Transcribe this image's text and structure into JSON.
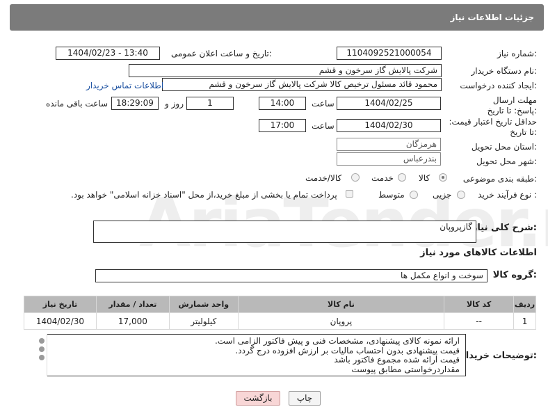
{
  "header": {
    "title": "جزئیات اطلاعات نیاز"
  },
  "watermark": "AriaTender.neT",
  "fields": {
    "need_number_label": "شماره نیاز:",
    "need_number": "1104092521000054",
    "announce_label": "تاریخ و ساعت اعلان عمومی:",
    "announce_value": "1404/02/23 - 13:40",
    "buyer_label": "نام دستگاه خریدار:",
    "buyer_value": "شرکت پالایش گاز سرخون و قشم",
    "creator_label": "ایجاد کننده درخواست:",
    "creator_value": "محمود قائد مسئول ترخیص کالا شرکت پالایش گاز سرخون و قشم",
    "contact_link": "اطلاعات تماس خریدار",
    "deadline_label": "مهلت ارسال پاسخ: تا تاریخ:",
    "deadline_date": "1404/02/25",
    "time_label": "ساعت",
    "deadline_time": "14:00",
    "days_value": "1",
    "days_label": "روز و",
    "remaining_time": "18:29:09",
    "remaining_label": "ساعت باقی مانده",
    "validity_label": "حداقل تاریخ اعتبار قیمت: تا تاریخ:",
    "validity_date": "1404/02/30",
    "validity_time_label": "ساعت",
    "validity_time": "17:00",
    "province_label": "استان محل تحویل:",
    "province_value": "هرمزگان",
    "city_label": "شهر محل تحویل:",
    "city_value": "بندرعباس",
    "category_label": "طبقه بندی موضوعی:",
    "category_options": [
      "کالا",
      "خدمت",
      "کالا/خدمت"
    ],
    "process_label": "نوع فرآیند خرید :",
    "process_options": [
      "جزیی",
      "متوسط"
    ],
    "payment_note": "پرداخت تمام یا بخشی از مبلغ خرید،از محل \"اسناد خزانه اسلامی\" خواهد بود."
  },
  "summary": {
    "label": "شرح کلی نیاز:",
    "value": "گازپروپان"
  },
  "items_section": {
    "title": "اطلاعات کالاهای مورد نیاز",
    "group_label": "گروه کالا:",
    "group_value": "سوخت و انواع مکمل ها"
  },
  "table": {
    "headers": [
      "ردیف",
      "کد کالا",
      "نام کالا",
      "واحد شمارش",
      "تعداد / مقدار",
      "تاریخ نیاز"
    ],
    "rows": [
      [
        "1",
        "--",
        "پروپان",
        "کیلولیتر",
        "17,000",
        "1404/02/30"
      ]
    ]
  },
  "buyer_notes": {
    "label": "توضیحات خریدار:",
    "lines": [
      "ارائه نمونه کالای پیشنهادی، مشخصات فنی و پیش فاکتور الزامی است.",
      "قیمت پیشنهادی بدون احتساب مالیات بر ارزش افزوده درج گردد.",
      "قیمت ارائه شده مجموع فاکتور باشد",
      "مقداردرخواستی مطابق پیوست"
    ]
  },
  "buttons": {
    "print": "چاپ",
    "back": "بازگشت"
  }
}
